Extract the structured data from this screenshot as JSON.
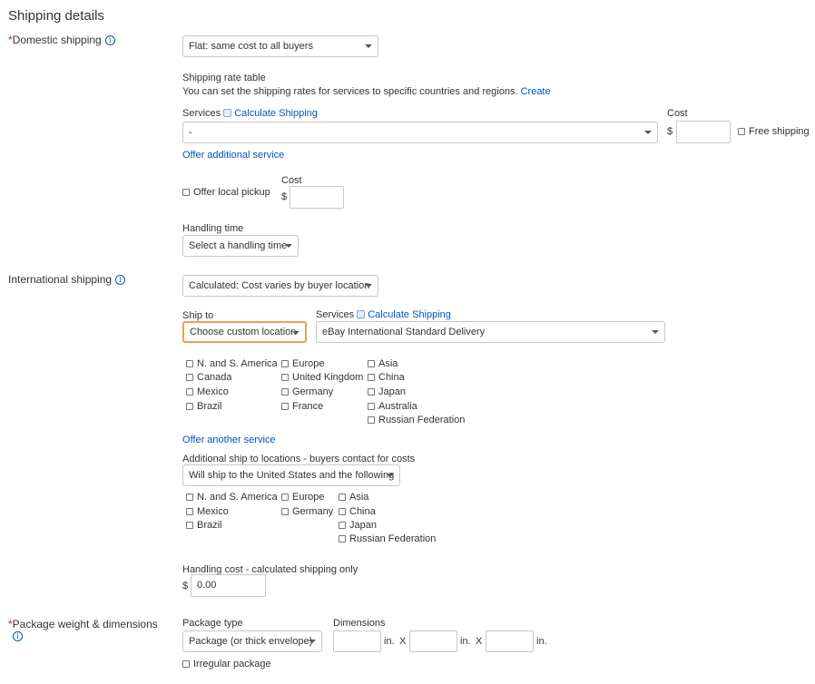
{
  "title": "Shipping details",
  "domestic": {
    "label": "Domestic shipping",
    "type_select": "Flat: same cost to all buyers",
    "rate_table_title": "Shipping rate table",
    "rate_table_desc": "You can set the shipping rates for services to specific countries and regions.",
    "create_link": "Create",
    "services_label": "Services",
    "calc_link": "Calculate Shipping",
    "service_select": "-",
    "cost_label": "Cost",
    "currency": "$",
    "free_shipping": "Free shipping",
    "offer_additional": "Offer additional service",
    "local_pickup": "Offer local pickup",
    "pickup_cost_label": "Cost",
    "pickup_currency": "$",
    "handling_label": "Handling time",
    "handling_select": "Select a handling time"
  },
  "international": {
    "label": "International shipping",
    "type_select": "Calculated: Cost varies by buyer location",
    "ship_to_label": "Ship to",
    "ship_to_select": "Choose custom location",
    "services_label": "Services",
    "calc_link": "Calculate Shipping",
    "service_select": "eBay International Standard Delivery",
    "regions_col1": [
      "N. and S. America",
      "Canada",
      "Mexico",
      "Brazil"
    ],
    "regions_col2": [
      "Europe",
      "United Kingdom",
      "Germany",
      "France"
    ],
    "regions_col3": [
      "Asia",
      "China",
      "Japan",
      "Australia",
      "Russian Federation"
    ],
    "offer_another": "Offer another service",
    "additional_label": "Additional ship to locations - buyers contact for costs",
    "additional_select": "Will ship to the United States and the following",
    "add_col1": [
      "N. and S. America",
      "Mexico",
      "Brazil"
    ],
    "add_col2": [
      "Europe",
      "Germany"
    ],
    "add_col3": [
      "Asia",
      "China",
      "Japan",
      "Russian Federation"
    ],
    "handling_cost_label": "Handling cost - calculated shipping only",
    "handling_currency": "$",
    "handling_cost_value": "0.00"
  },
  "package": {
    "label": "Package weight & dimensions",
    "type_label": "Package type",
    "type_select": "Package (or thick envelope)",
    "dimensions_label": "Dimensions",
    "unit": "in.",
    "times": "X",
    "irregular": "Irregular package"
  }
}
